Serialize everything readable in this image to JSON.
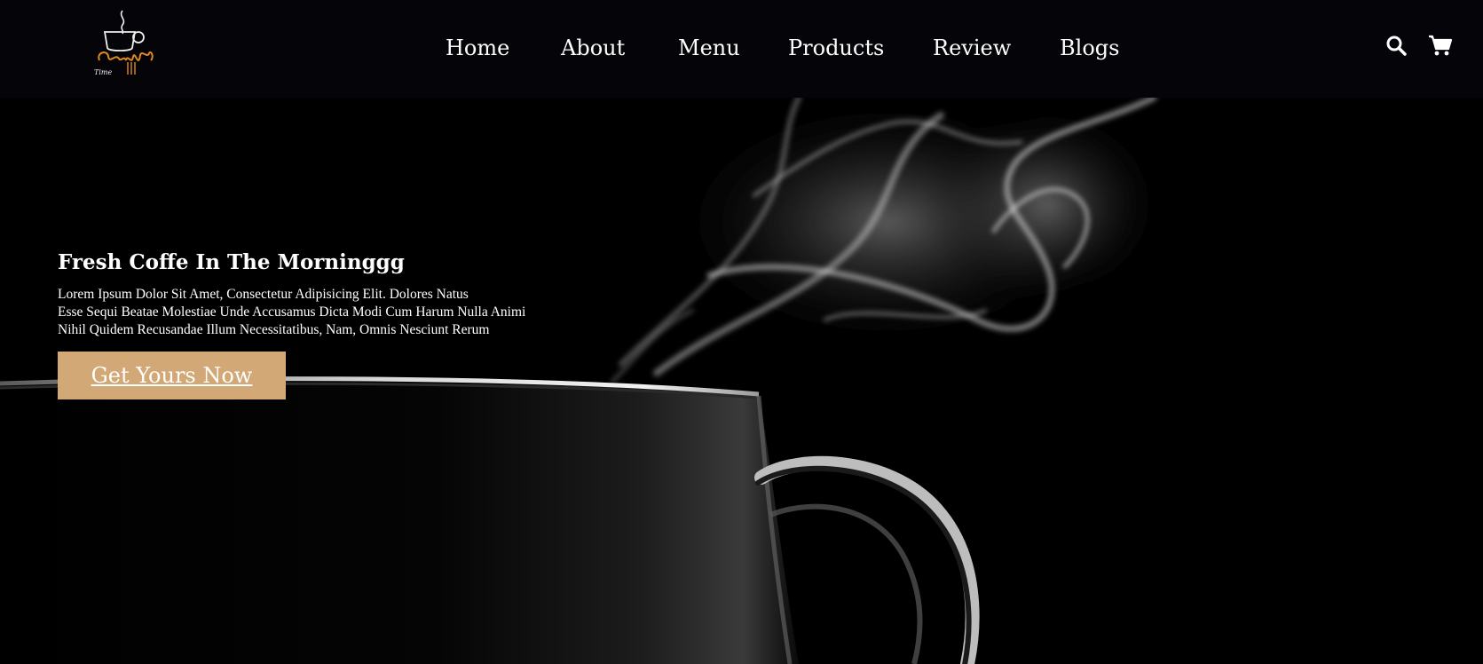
{
  "brand": {
    "logo_word": "Coffee",
    "logo_subword": "Time",
    "logo_color": "#e08a1e"
  },
  "nav": {
    "items": [
      {
        "label": "Home"
      },
      {
        "label": "About"
      },
      {
        "label": "Menu"
      },
      {
        "label": "Products"
      },
      {
        "label": "Review"
      },
      {
        "label": "Blogs"
      }
    ]
  },
  "header_icons": {
    "search": "search-icon",
    "cart": "shopping-cart-icon"
  },
  "hero": {
    "title": "Fresh Coffe In The Morninggg",
    "text_lines": [
      "Lorem Ipsum Dolor Sit Amet, Consectetur Adipisicing Elit. Dolores Natus",
      "Esse Sequi Beatae Molestiae Unde Accusamus Dicta Modi Cum Harum Nulla Animi",
      "Nihil Quidem Recusandae Illum Necessitatibus, Nam, Omnis Nesciunt Rerum"
    ],
    "cta_label": "Get Yours Now",
    "background_image": "steaming-coffee-cup"
  },
  "colors": {
    "background": "#030307",
    "accent": "#d3a877",
    "text": "#ffffff"
  }
}
